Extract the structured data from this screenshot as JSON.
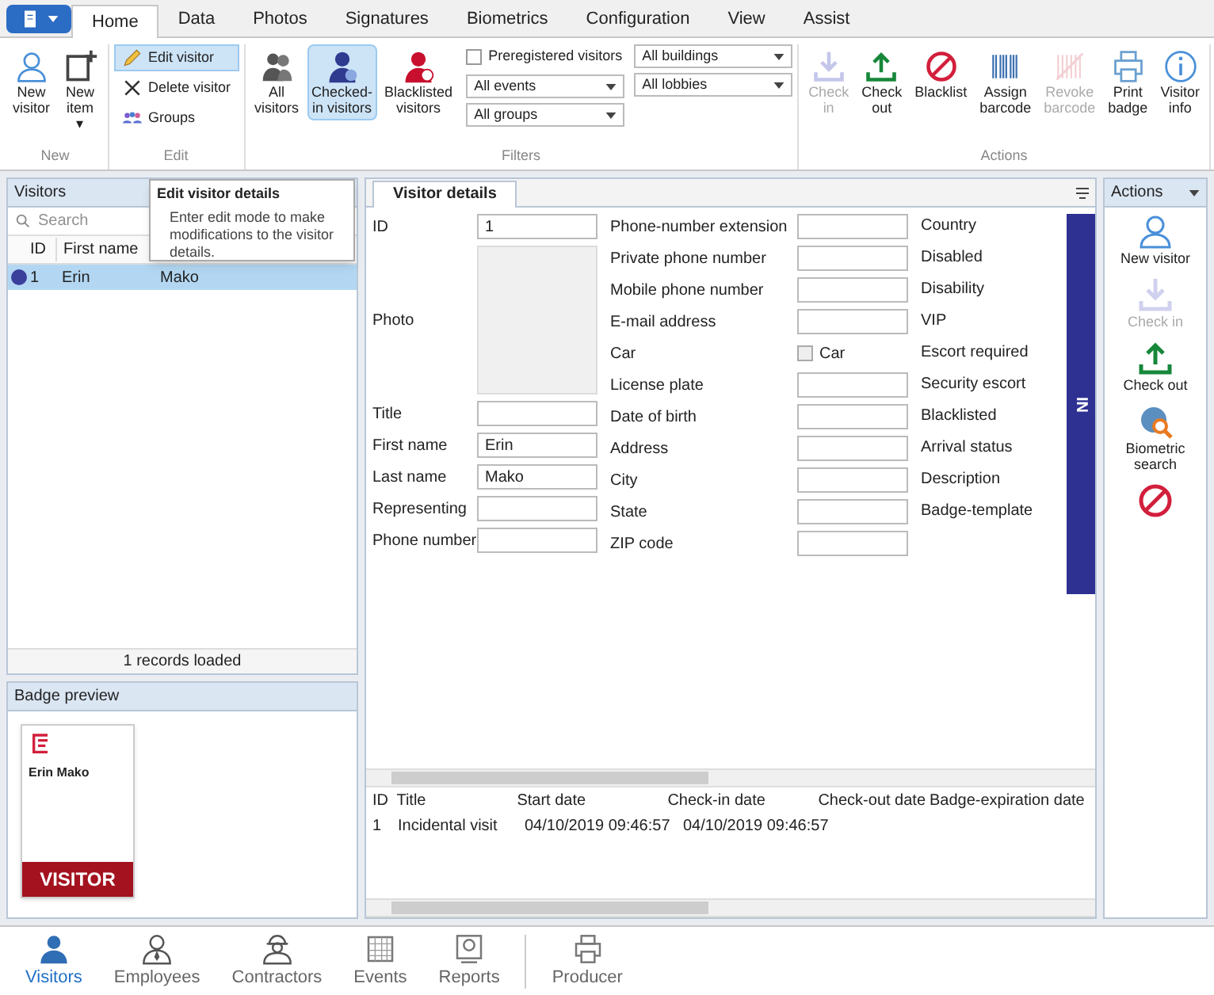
{
  "ribbon_tabs": [
    {
      "label": "Home",
      "selected": true
    },
    {
      "label": "Data",
      "selected": false
    },
    {
      "label": "Photos",
      "selected": false
    },
    {
      "label": "Signatures",
      "selected": false
    },
    {
      "label": "Biometrics",
      "selected": false
    },
    {
      "label": "Configuration",
      "selected": false
    },
    {
      "label": "View",
      "selected": false
    },
    {
      "label": "Assist",
      "selected": false
    }
  ],
  "ribbon_groups": [
    {
      "title": "New",
      "items": [
        {
          "kind": "large",
          "label": "New visitor",
          "selected": false,
          "disabled": false
        },
        {
          "kind": "large",
          "label": "New item ▾",
          "selected": false,
          "disabled": false
        }
      ]
    },
    {
      "title": "Edit",
      "items": [
        {
          "kind": "small",
          "label": "Edit visitor",
          "selected": true
        },
        {
          "kind": "small",
          "label": "Delete visitor",
          "selected": false
        },
        {
          "kind": "small",
          "label": "Groups",
          "selected": false
        }
      ]
    },
    {
      "title": "Filters",
      "items": [
        {
          "kind": "large",
          "label": "All visitors",
          "selected": false,
          "disabled": false
        },
        {
          "kind": "large",
          "label": "Checked-in visitors",
          "selected": true,
          "disabled": false
        },
        {
          "kind": "large",
          "label": "Blacklisted visitors",
          "selected": false,
          "disabled": false
        },
        {
          "kind": "check",
          "label": "Preregistered visitors",
          "checked": false
        },
        {
          "kind": "select",
          "value": "All events"
        },
        {
          "kind": "select",
          "value": "All groups"
        },
        {
          "kind": "select",
          "value": "All buildings"
        },
        {
          "kind": "select",
          "value": "All lobbies"
        }
      ]
    },
    {
      "title": "Actions",
      "items": [
        {
          "kind": "large",
          "label": "Check in",
          "selected": false,
          "disabled": true
        },
        {
          "kind": "large",
          "label": "Check out",
          "selected": false,
          "disabled": false
        },
        {
          "kind": "large",
          "label": "Blacklist",
          "selected": false,
          "disabled": false
        },
        {
          "kind": "large",
          "label": "Assign barcode",
          "selected": false,
          "disabled": false
        },
        {
          "kind": "large",
          "label": "Revoke barcode",
          "selected": false,
          "disabled": true
        },
        {
          "kind": "large",
          "label": "Print badge",
          "selected": false,
          "disabled": false
        },
        {
          "kind": "large",
          "label": "Visitor info",
          "selected": false,
          "disabled": false
        }
      ]
    }
  ],
  "visitors_panel": {
    "title": "Visitors",
    "search": {
      "placeholder": "Search"
    },
    "columns": [
      "ID",
      "First name"
    ],
    "rows": [
      {
        "color": "#3a3f9c",
        "id": "1",
        "first_name": "Erin",
        "last_name": "Mako",
        "selected": true
      }
    ],
    "footer": "1 records loaded"
  },
  "tooltip": {
    "title": "Edit visitor details",
    "text": "Enter edit mode to make modifications to the visitor details."
  },
  "badge_preview": {
    "title": "Badge preview",
    "name": "Erin Mako",
    "banner": "VISITOR"
  },
  "details": {
    "tab": "Visitor details",
    "column_1": [
      {
        "kind": "text",
        "label": "ID",
        "value": "1"
      },
      {
        "kind": "photo",
        "label": "Photo"
      },
      {
        "kind": "text",
        "label": "Title"
      },
      {
        "kind": "text",
        "label": "First name",
        "value": "Erin"
      },
      {
        "kind": "text",
        "label": "Last name",
        "value": "Mako"
      },
      {
        "kind": "text",
        "label": "Representing"
      },
      {
        "kind": "text",
        "label": "Phone number"
      }
    ],
    "column_2": [
      {
        "kind": "text",
        "label": "Phone-number extension"
      },
      {
        "kind": "text",
        "label": "Private phone number"
      },
      {
        "kind": "text",
        "label": "Mobile phone number"
      },
      {
        "kind": "text",
        "label": "E-mail address"
      },
      {
        "kind": "check",
        "label": "Car",
        "check_label": "Car",
        "checked": false
      },
      {
        "kind": "text",
        "label": "License plate"
      },
      {
        "kind": "text",
        "label": "Date of birth"
      },
      {
        "kind": "text",
        "label": "Address"
      },
      {
        "kind": "text",
        "label": "City"
      },
      {
        "kind": "text",
        "label": "State"
      },
      {
        "kind": "text",
        "label": "ZIP code"
      }
    ],
    "column_3": [
      "Country",
      "Disabled",
      "Disability",
      "VIP",
      "Escort required",
      "Security escort",
      "Blacklisted",
      "Arrival status",
      "Description",
      "Badge-template"
    ],
    "status_strip": "IN"
  },
  "visits_table": {
    "columns": [
      "ID",
      "Title",
      "Start date",
      "Check-in date",
      "Check-out date",
      "Badge-expiration date"
    ],
    "rows": [
      [
        "1",
        "Incidental visit",
        "04/10/2019 09:46:57",
        "04/10/2019 09:46:57"
      ]
    ]
  },
  "actions_panel": {
    "title": "Actions",
    "items": [
      {
        "label": "New visitor",
        "disabled": false
      },
      {
        "label": "Check in",
        "disabled": true
      },
      {
        "label": "Check out",
        "disabled": false
      },
      {
        "label": "Biometric search",
        "disabled": false
      },
      {
        "disabled": false
      }
    ]
  },
  "bottom_nav": [
    {
      "label": "Visitors",
      "selected": true
    },
    {
      "label": "Employees",
      "selected": false
    },
    {
      "label": "Contractors",
      "selected": false
    },
    {
      "label": "Events",
      "selected": false
    },
    {
      "label": "Reports",
      "selected": false
    },
    {
      "label": "Producer",
      "selected": false
    }
  ]
}
